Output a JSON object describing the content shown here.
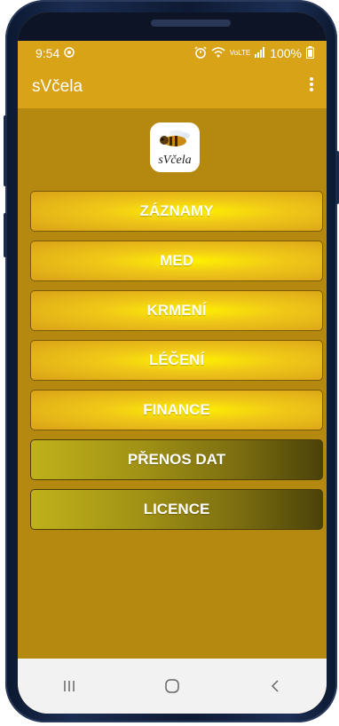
{
  "status_bar": {
    "time": "9:54",
    "battery": "100%"
  },
  "app_bar": {
    "title": "sVčela",
    "menu_icon": "more-vert-icon"
  },
  "logo": {
    "text": "sVčela",
    "image": "bee-icon"
  },
  "menu": {
    "items": [
      {
        "label": "ZÁZNAMY"
      },
      {
        "label": "MED"
      },
      {
        "label": "KRMENÍ"
      },
      {
        "label": "LÉČENÍ"
      },
      {
        "label": "FINANCE"
      },
      {
        "label": "PŘENOS DAT"
      },
      {
        "label": "LICENCE"
      }
    ]
  },
  "nav_bar": {
    "recents_icon": "recents-icon",
    "home_icon": "home-icon",
    "back_icon": "back-icon"
  },
  "colors": {
    "app_bar": "#d9a318",
    "background": "#b58910",
    "button_gold": "#f0c818",
    "button_olive": "#7d6f10"
  }
}
